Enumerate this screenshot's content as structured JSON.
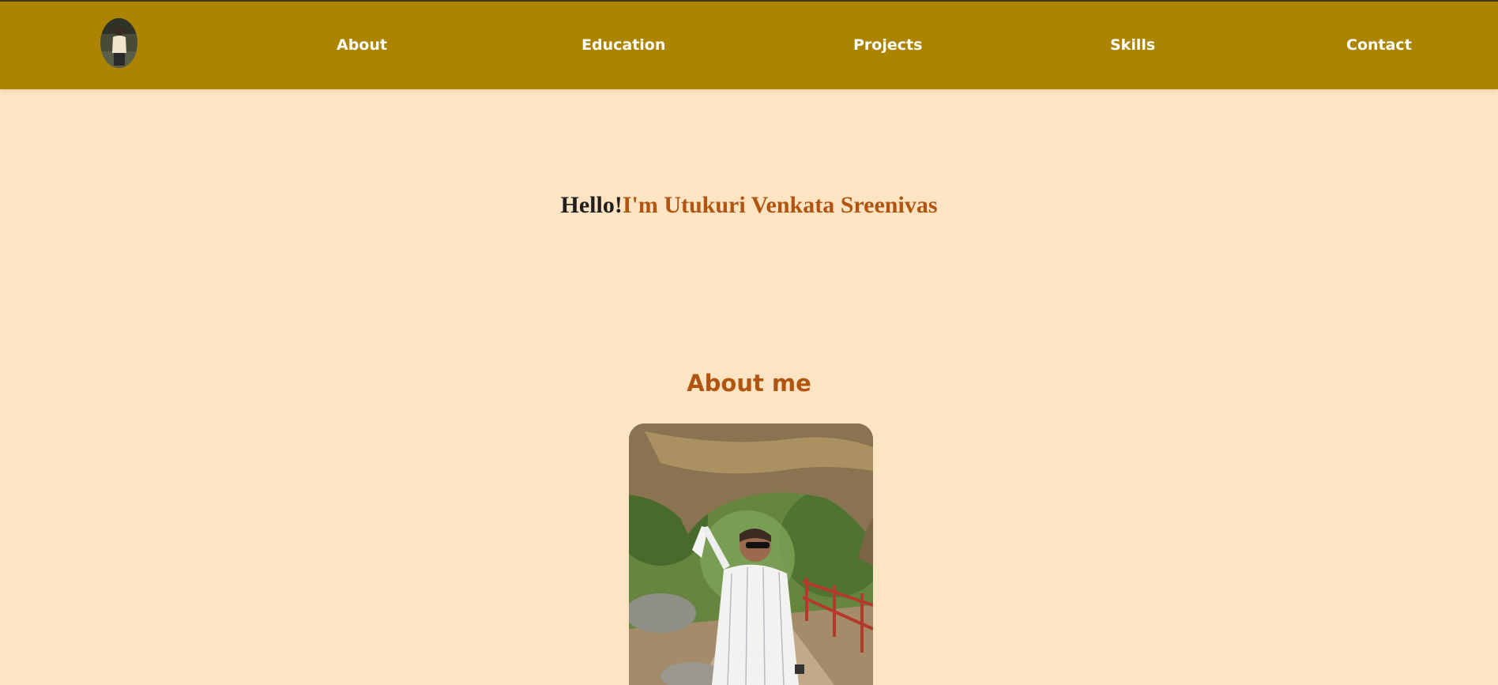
{
  "nav": {
    "avatar_alt": "profile-avatar",
    "links": [
      {
        "label": "About"
      },
      {
        "label": "Education"
      },
      {
        "label": "Projects"
      },
      {
        "label": "Skills"
      },
      {
        "label": "Contact"
      }
    ]
  },
  "hero": {
    "greeting": "Hello!",
    "name_line": "I'm Utukuri Venkata Sreenivas"
  },
  "about": {
    "heading": "About me"
  },
  "colors": {
    "navbar_bg": "#ad8400",
    "page_bg": "#ffe4c4",
    "accent": "#b15410",
    "nav_text": "#ffffff"
  }
}
